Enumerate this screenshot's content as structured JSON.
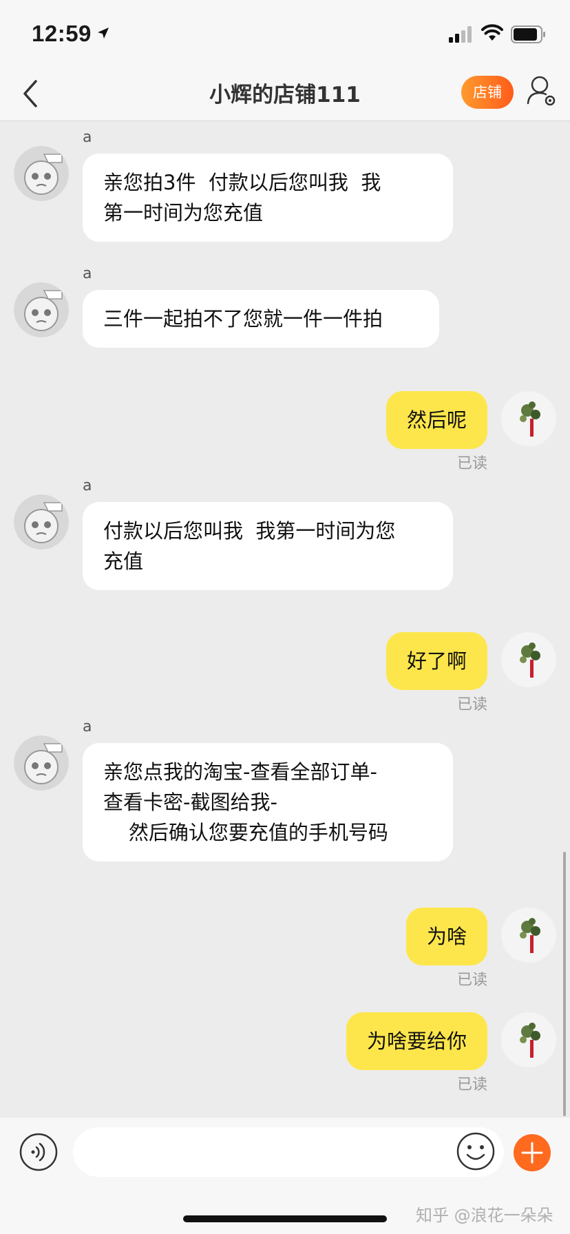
{
  "status_bar": {
    "time": "12:59"
  },
  "header": {
    "title": "小辉的店铺111",
    "shop_button": "店铺"
  },
  "messages": [
    {
      "side": "in",
      "sender": "a",
      "text": "亲您拍3件  付款以后您叫我  我\n第一时间为您充值"
    },
    {
      "side": "in",
      "sender": "a",
      "text": "三件一起拍不了您就一件一件拍"
    },
    {
      "side": "out",
      "text": "然后呢",
      "status": "已读"
    },
    {
      "side": "in",
      "sender": "a",
      "text": "付款以后您叫我  我第一时间为您\n充值"
    },
    {
      "side": "out",
      "text": "好了啊",
      "status": "已读"
    },
    {
      "side": "in",
      "sender": "a",
      "text": "亲您点我的淘宝-查看全部订单-\n查看卡密-截图给我-\n    然后确认您要充值的手机号码"
    },
    {
      "side": "out",
      "text": "为啥",
      "status": "已读"
    },
    {
      "side": "out",
      "text": "为啥要给你",
      "status": "已读"
    }
  ],
  "input": {
    "placeholder": ""
  },
  "watermark": "知乎 @浪花一朵朵",
  "colors": {
    "accent": "#ff6a1f",
    "out_bubble": "#fde64b",
    "in_bubble": "#ffffff"
  }
}
